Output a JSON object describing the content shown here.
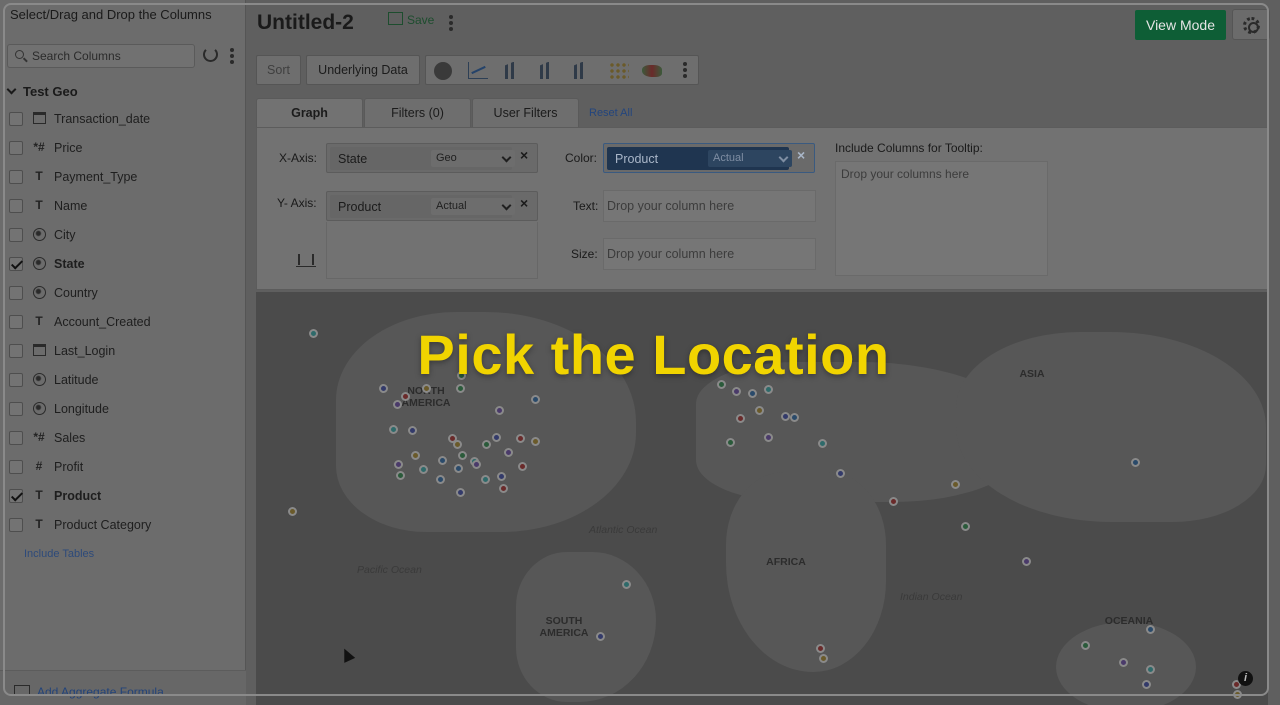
{
  "sidebar": {
    "title": "Select/Drag and Drop the Columns",
    "search_placeholder": "Search Columns",
    "group": "Test Geo",
    "columns": [
      {
        "type": "calendar-icon",
        "name": "Transaction_date",
        "checked": false
      },
      {
        "type": "*#",
        "name": "Price",
        "checked": false
      },
      {
        "type": "T",
        "name": "Payment_Type",
        "checked": false
      },
      {
        "type": "T",
        "name": "Name",
        "checked": false
      },
      {
        "type": "globe-icon",
        "name": "City",
        "checked": false
      },
      {
        "type": "globe-icon",
        "name": "State",
        "checked": true
      },
      {
        "type": "globe-icon",
        "name": "Country",
        "checked": false
      },
      {
        "type": "T",
        "name": "Account_Created",
        "checked": false
      },
      {
        "type": "calendar-icon",
        "name": "Last_Login",
        "checked": false
      },
      {
        "type": "globe-icon",
        "name": "Latitude",
        "checked": false
      },
      {
        "type": "globe-icon",
        "name": "Longitude",
        "checked": false
      },
      {
        "type": "*#",
        "name": "Sales",
        "checked": false
      },
      {
        "type": "#",
        "name": "Profit",
        "checked": false
      },
      {
        "type": "T",
        "name": "Product",
        "checked": true
      },
      {
        "type": "T",
        "name": "Product Category",
        "checked": false
      }
    ],
    "include_tables": "Include Tables",
    "add_formula": "Add Aggregate Formula"
  },
  "header": {
    "title": "Untitled-2",
    "save_label": "Save",
    "view_mode": "View Mode"
  },
  "toolbar": {
    "sort": "Sort",
    "underlying": "Underlying Data"
  },
  "tabs": [
    "Graph",
    "Filters (0)",
    "User Filters"
  ],
  "reset_all": "Reset All",
  "config": {
    "x_label": "X-Axis:",
    "x_field": "State",
    "x_agg": "Geo",
    "y_label": "Y- Axis:",
    "y_field": "Product",
    "y_agg": "Actual",
    "color_label": "Color:",
    "color_field": "Product",
    "color_agg": "Actual",
    "text_label": "Text:",
    "text_placeholder": "Drop your column here",
    "size_label": "Size:",
    "size_placeholder": "Drop your column here",
    "tooltip_label": "Include Columns for Tooltip:",
    "tooltip_placeholder": "Drop your columns here"
  },
  "map": {
    "labels": {
      "north_america": "NORTH\nAMERICA",
      "south_america": "SOUTH\nAMERICA",
      "africa": "AFRICA",
      "asia": "ASIA",
      "oceania": "OCEANIA",
      "atlantic": "Atlantic Ocean",
      "pacific": "Pacific Ocean",
      "indian": "Indian Ocean"
    }
  },
  "overlay_caption": "Pick the Location",
  "colors": {
    "view_mode_bg": "#0e5e36",
    "caption": "#f1d400",
    "color_pill": "#1f3550"
  }
}
